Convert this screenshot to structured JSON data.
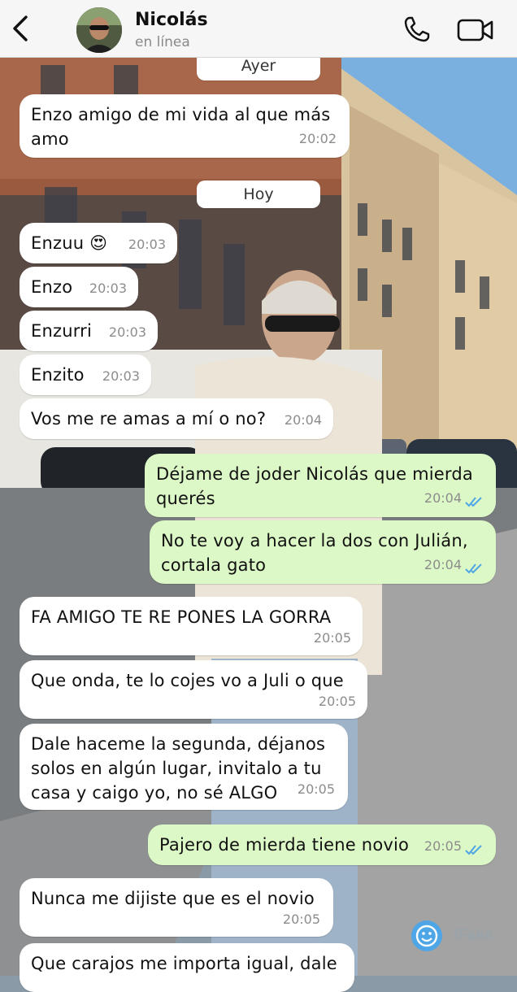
{
  "header": {
    "contact_name": "Nicolás",
    "status": "en línea",
    "icons": [
      "chevron-left-icon",
      "phone-icon",
      "video-camera-icon"
    ]
  },
  "dividers": [
    "Ayer",
    "Hoy"
  ],
  "messages": [
    {
      "direction": "in",
      "text": "Enzo amigo de mi vida al que más\namo",
      "time": "20:02"
    },
    {
      "direction": "in",
      "text": "Enzuu 😍",
      "time": "20:03"
    },
    {
      "direction": "in",
      "text": "Enzo",
      "time": "20:03"
    },
    {
      "direction": "in",
      "text": "Enzurri",
      "time": "20:03"
    },
    {
      "direction": "in",
      "text": "Enzito",
      "time": "20:03"
    },
    {
      "direction": "in",
      "text": "Vos me re amas a mí o no?",
      "time": "20:04"
    },
    {
      "direction": "out",
      "text": "Déjame de joder Nicolás que mierda\nquerés",
      "time": "20:04",
      "status": "read"
    },
    {
      "direction": "out",
      "text": "No te voy a hacer la dos con Julián,\ncortala gato",
      "time": "20:04",
      "status": "read"
    },
    {
      "direction": "in",
      "text": "FA AMIGO TE RE PONES LA GORRA",
      "time": "20:05"
    },
    {
      "direction": "in",
      "text": "Que onda, te lo cojes vo a Juli o que",
      "time": "20:05"
    },
    {
      "direction": "in",
      "text": "Dale haceme la segunda, déjanos\nsolos en algún lugar, invitalo a tu\ncasa y caigo yo, no sé ALGO",
      "time": "20:05"
    },
    {
      "direction": "out",
      "text": "Pajero de mierda tiene novio",
      "time": "20:05",
      "status": "read"
    },
    {
      "direction": "in",
      "text": "Nunca me dijiste que es el novio",
      "time": "20:05"
    },
    {
      "direction": "in",
      "text": "Que carajos me importa igual, dale",
      "time": ""
    }
  ],
  "watermark": "iFake",
  "colors": {
    "header_bg": "#f6f6f6",
    "incoming_bubble": "#ffffff",
    "outgoing_bubble": "#dcf8c6",
    "read_ticks": "#4fa6e6",
    "timestamp": "#8c8c8c"
  }
}
